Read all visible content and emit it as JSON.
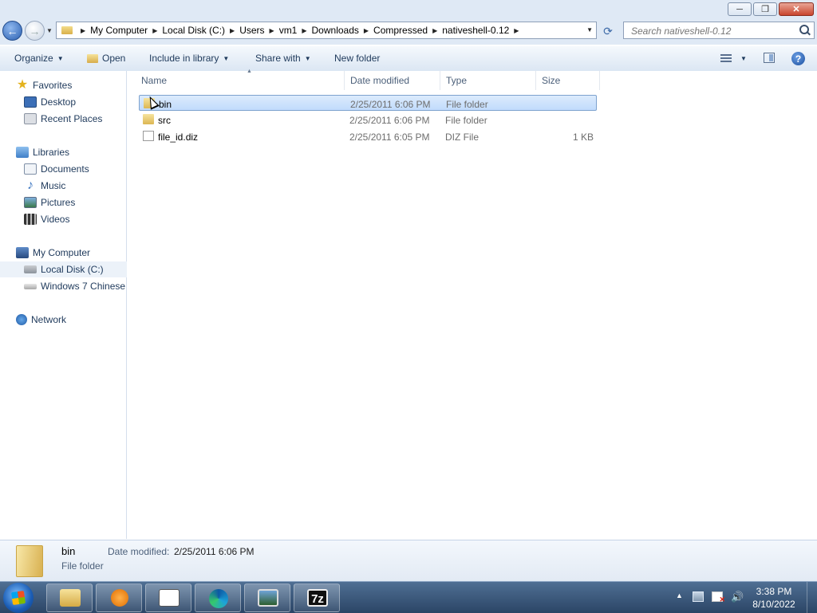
{
  "window": {
    "minimize_label": "─",
    "maximize_label": "❐",
    "close_label": "✕"
  },
  "address": {
    "crumbs": [
      "My Computer",
      "Local Disk (C:)",
      "Users",
      "vm1",
      "Downloads",
      "Compressed",
      "nativeshell-0.12"
    ],
    "search_placeholder": "Search nativeshell-0.12"
  },
  "toolbar": {
    "organize": "Organize",
    "open": "Open",
    "include_in_library": "Include in library",
    "share_with": "Share with",
    "new_folder": "New folder"
  },
  "navpane": {
    "favorites": "Favorites",
    "desktop": "Desktop",
    "recent_places": "Recent Places",
    "libraries": "Libraries",
    "documents": "Documents",
    "music": "Music",
    "pictures": "Pictures",
    "videos": "Videos",
    "my_computer": "My Computer",
    "local_disk": "Local Disk (C:)",
    "windows7_chinese": "Windows 7 Chinese",
    "network": "Network"
  },
  "columns": {
    "name": "Name",
    "date_modified": "Date modified",
    "type": "Type",
    "size": "Size"
  },
  "files": [
    {
      "name": "bin",
      "date": "2/25/2011 6:06 PM",
      "type": "File folder",
      "size": "",
      "icon": "folder-icon",
      "selected": true
    },
    {
      "name": "src",
      "date": "2/25/2011 6:06 PM",
      "type": "File folder",
      "size": "",
      "icon": "folder-icon",
      "selected": false
    },
    {
      "name": "file_id.diz",
      "date": "2/25/2011 6:05 PM",
      "type": "DIZ File",
      "size": "1 KB",
      "icon": "file-icon",
      "selected": false
    }
  ],
  "details": {
    "name": "bin",
    "type": "File folder",
    "date_label": "Date modified:",
    "date_value": "2/25/2011 6:06 PM"
  },
  "taskbar": {
    "apps": [
      "windows-explorer",
      "media-player",
      "notepad",
      "edge",
      "photo-viewer",
      "7-zip"
    ],
    "sevenzip_label": "7z",
    "time": "3:38 PM",
    "date": "8/10/2022"
  }
}
